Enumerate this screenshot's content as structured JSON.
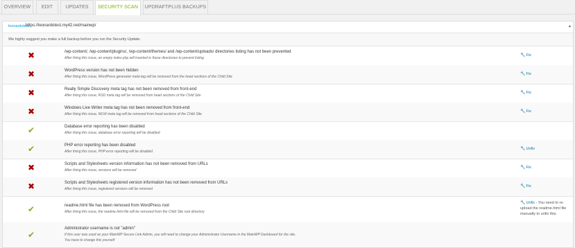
{
  "tabs": [
    {
      "label": "OVERVIEW",
      "active": false
    },
    {
      "label": "EDIT",
      "active": false
    },
    {
      "label": "UPDATES",
      "active": false
    },
    {
      "label": "SECURITY SCAN",
      "active": true
    },
    {
      "label": "UPDRAFTPLUS BACKUPS",
      "active": false
    }
  ],
  "site": {
    "name": "leonardotest",
    "url": "https://leonardotest.my42.net/mainwp/"
  },
  "notice": "We highly suggest you make a full backup before you run the Security Update.",
  "colors": {
    "accent": "#7fb100",
    "bad": "#aa0000",
    "good": "#7ab317",
    "link": "#0073aa"
  },
  "checks": [
    {
      "status": "bad",
      "icon": "cross-icon",
      "title": "/wp-content/, /wp-content/plugins/, /wp-content/themes/ and /wp-content/uploads/ directories listing has not been prevented",
      "desc": "After fixing this issue, an empty index.php will inserted in these directories to prevent listing",
      "action": "Fix"
    },
    {
      "status": "bad",
      "icon": "cross-icon",
      "title": "WordPress version has not been hidden",
      "desc": "After fixing this issue, WordPress generator meta tag will be removed from the head sections of the Child Site",
      "action": "Fix"
    },
    {
      "status": "bad",
      "icon": "cross-icon",
      "title": "Really Simple Discovery meta tag has not been removed from front-end",
      "desc": "After fixing this issue, RSD meta tag will be removed from head sections of the Child Site",
      "action": "Fix"
    },
    {
      "status": "bad",
      "icon": "cross-icon",
      "title": "Windows Live Writer meta tag has not been removed from front-end",
      "desc": "After fixing this issue, WLW meta tag will be removed from head sections of the Child Site",
      "action": "Fix"
    },
    {
      "status": "good",
      "icon": "check-icon",
      "title": "Database error reporting has been disabled",
      "desc": "After fixing this issue, database error reporting will be disabled",
      "action": ""
    },
    {
      "status": "good",
      "icon": "check-icon",
      "title": "PHP error reporting has been disabled",
      "desc": "After fixing this issue, PHP error reporting will be disabled",
      "action": "Unfix"
    },
    {
      "status": "bad",
      "icon": "cross-icon",
      "title": "Scripts and Stylesheets version information has not been removed from URLs",
      "desc": "After fixing this issue, versions will be removed",
      "action": "Fix"
    },
    {
      "status": "bad",
      "icon": "cross-icon",
      "title": "Scripts and Stylesheets registered version information has not been removed from URLs",
      "desc": "After fixing this issue, registered versions will be removed",
      "action": "Fix"
    },
    {
      "status": "good",
      "icon": "check-icon",
      "title": "readme.html file has been removed from WordPress root",
      "desc": "After fixing this issue, the readme.html file will be removed from the Child Site root directory",
      "action": "Unfix",
      "action_note": " - You need to re-upload the readme.html file manually to unfix this."
    },
    {
      "status": "good",
      "icon": "check-icon",
      "title": "Administrator username is not \"admin\"",
      "desc": "If this user was used as your MainWP Secure Link Admin, you will need to change your Administrator Username in the MainWP Dashboard for the site.",
      "desc2": "You have to change this yourself",
      "action": ""
    }
  ]
}
